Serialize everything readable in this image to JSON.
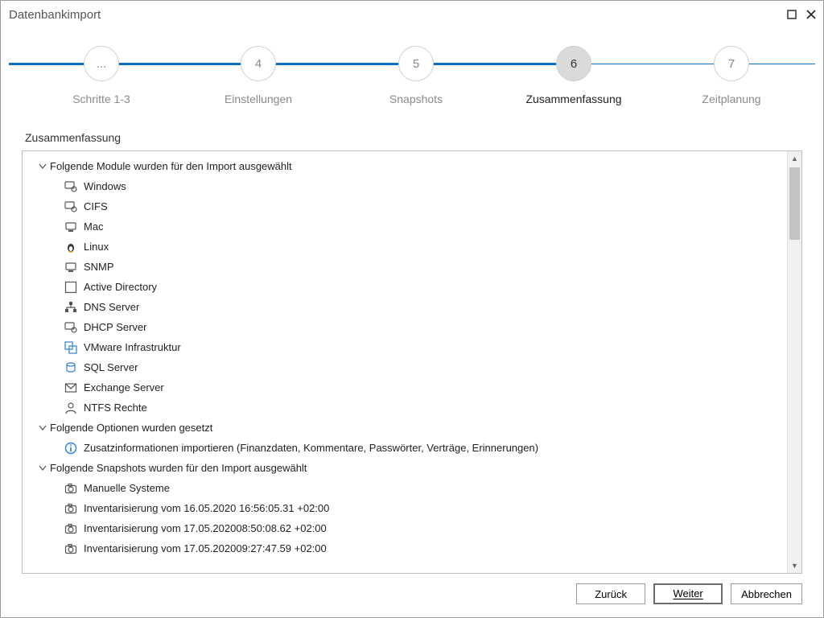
{
  "window": {
    "title": "Datenbankimport"
  },
  "stepper": {
    "nodes": [
      {
        "id": "steps13",
        "marker": "...",
        "label": "Schritte 1-3",
        "active": false
      },
      {
        "id": "settings",
        "marker": "4",
        "label": "Einstellungen",
        "active": false
      },
      {
        "id": "snapshots",
        "marker": "5",
        "label": "Snapshots",
        "active": false
      },
      {
        "id": "summary",
        "marker": "6",
        "label": "Zusammenfassung",
        "active": true
      },
      {
        "id": "schedule",
        "marker": "7",
        "label": "Zeitplanung",
        "active": false
      }
    ]
  },
  "section_heading": "Zusammenfassung",
  "tree": {
    "groups": [
      {
        "title": "Folgende Module wurden für den Import ausgewählt",
        "items": [
          {
            "icon": "windows-icon",
            "label": "Windows"
          },
          {
            "icon": "cifs-icon",
            "label": "CIFS"
          },
          {
            "icon": "mac-icon",
            "label": "Mac"
          },
          {
            "icon": "linux-icon",
            "label": "Linux"
          },
          {
            "icon": "snmp-icon",
            "label": "SNMP"
          },
          {
            "icon": "ad-icon",
            "label": "Active Directory"
          },
          {
            "icon": "dns-icon",
            "label": "DNS Server"
          },
          {
            "icon": "dhcp-icon",
            "label": "DHCP Server"
          },
          {
            "icon": "vmware-icon",
            "label": "VMware Infrastruktur"
          },
          {
            "icon": "sql-icon",
            "label": "SQL Server"
          },
          {
            "icon": "exchange-icon",
            "label": "Exchange Server"
          },
          {
            "icon": "ntfs-icon",
            "label": "NTFS Rechte"
          }
        ]
      },
      {
        "title": "Folgende Optionen wurden gesetzt",
        "items": [
          {
            "icon": "info-icon",
            "label": "Zusatzinformationen importieren (Finanzdaten, Kommentare, Passwörter, Verträge, Erinnerungen)"
          }
        ]
      },
      {
        "title": "Folgende Snapshots wurden für den Import ausgewählt",
        "items": [
          {
            "icon": "camera-icon",
            "label": "Manuelle Systeme"
          },
          {
            "icon": "camera-icon",
            "label": "Inventarisierung vom 16.05.2020 16:56:05.31 +02:00"
          },
          {
            "icon": "camera-icon",
            "label": "Inventarisierung vom 17.05.202008:50:08.62 +02:00"
          },
          {
            "icon": "camera-icon",
            "label": "Inventarisierung vom 17.05.202009:27:47.59 +02:00"
          }
        ]
      }
    ]
  },
  "buttons": {
    "back": "Zurück",
    "next": "Weiter",
    "cancel": "Abbrechen"
  }
}
